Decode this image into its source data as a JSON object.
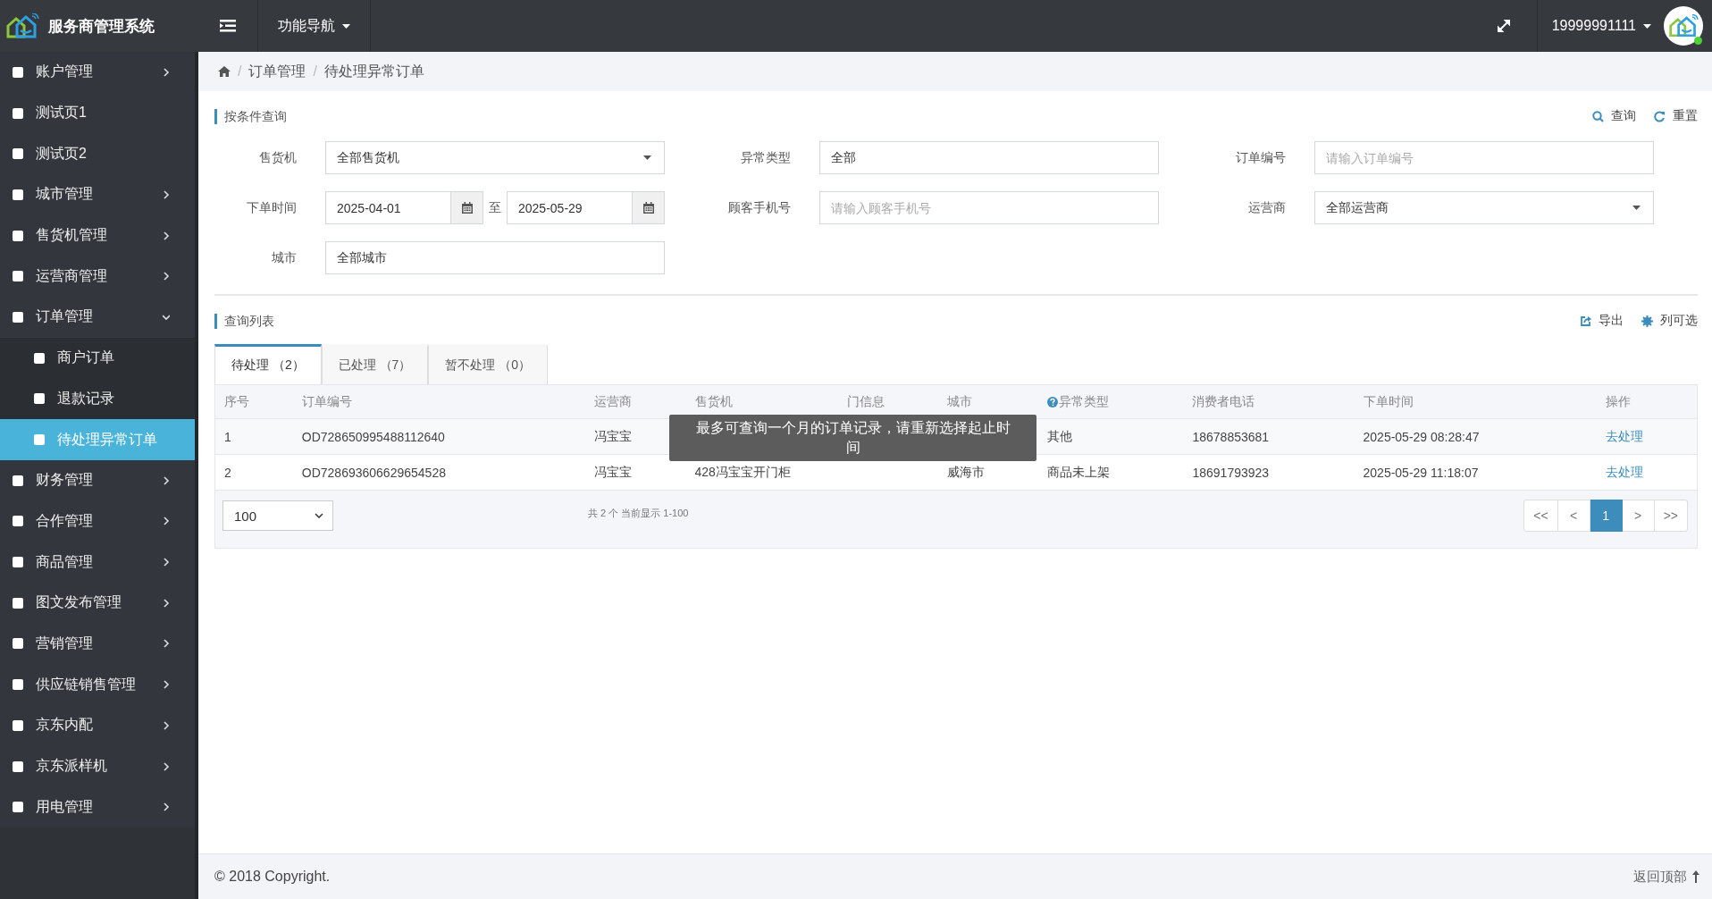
{
  "header": {
    "title": "服务商管理系统",
    "nav_menu": "功能导航",
    "user": "19999991111"
  },
  "sidebar": {
    "items": [
      {
        "label": "账户管理",
        "expanded": false,
        "selected": false
      },
      {
        "label": "测试页1",
        "selected": false
      },
      {
        "label": "测试页2",
        "selected": false
      },
      {
        "label": "城市管理",
        "expanded": false,
        "selected": false
      },
      {
        "label": "售货机管理",
        "expanded": false,
        "selected": false
      },
      {
        "label": "运营商管理",
        "expanded": false,
        "selected": false
      },
      {
        "label": "订单管理",
        "expanded": true,
        "selected": false,
        "children": [
          {
            "label": "商户订单",
            "selected": false
          },
          {
            "label": "退款记录",
            "selected": false
          },
          {
            "label": "待处理异常订单",
            "selected": true
          }
        ]
      },
      {
        "label": "财务管理",
        "expanded": false,
        "selected": false
      },
      {
        "label": "合作管理",
        "expanded": false,
        "selected": false
      },
      {
        "label": "商品管理",
        "expanded": false,
        "selected": false
      },
      {
        "label": "图文发布管理",
        "expanded": false,
        "selected": false
      },
      {
        "label": "营销管理",
        "expanded": false,
        "selected": false
      },
      {
        "label": "供应链销售管理",
        "expanded": false,
        "selected": false
      },
      {
        "label": "京东内配",
        "expanded": false,
        "selected": false
      },
      {
        "label": "京东派样机",
        "expanded": false,
        "selected": false
      },
      {
        "label": "用电管理",
        "expanded": false,
        "selected": false
      }
    ]
  },
  "breadcrumb": {
    "separator": "/",
    "items": [
      "订单管理",
      "待处理异常订单"
    ]
  },
  "filter": {
    "title": "按条件查询",
    "actions": [
      {
        "label": "查询",
        "kind": "search"
      },
      {
        "label": "重置",
        "kind": "reset"
      }
    ],
    "fields": [
      {
        "label": "售货机",
        "kind": "select",
        "value": "全部售货机"
      },
      {
        "label": "异常类型",
        "kind": "text",
        "value": "全部"
      },
      {
        "label": "订单编号",
        "kind": "text",
        "placeholder": "请输入订单编号"
      },
      {
        "label": "下单时间",
        "kind": "daterange",
        "from": "2025-04-01",
        "separator": "至",
        "to": "2025-05-29"
      },
      {
        "label": "顾客手机号",
        "kind": "text",
        "placeholder": "请输入顾客手机号"
      },
      {
        "label": "运营商",
        "kind": "select",
        "value": "全部运营商"
      },
      {
        "label": "城市",
        "kind": "text",
        "value": "全部城市"
      }
    ]
  },
  "list": {
    "title": "查询列表",
    "actions": [
      {
        "label": "导出",
        "kind": "export"
      },
      {
        "label": "列可选",
        "kind": "columns"
      }
    ],
    "tabs": [
      {
        "label": "待处理 （2）",
        "selected": true
      },
      {
        "label": "已处理 （7）",
        "selected": false
      },
      {
        "label": "暂不处理 （0）",
        "selected": false
      }
    ],
    "table": {
      "columns": [
        {
          "label": "序号"
        },
        {
          "label": "订单编号"
        },
        {
          "label": "运营商"
        },
        {
          "label": "售货机"
        },
        {
          "label": "门信息"
        },
        {
          "label": "城市"
        },
        {
          "label": "异常类型",
          "help": true
        },
        {
          "label": "消费者电话"
        },
        {
          "label": "下单时间"
        },
        {
          "label": "操作",
          "kind": "link"
        }
      ],
      "rows": [
        [
          "1",
          "OD728650995488112640",
          "冯宝宝",
          null,
          null,
          null,
          "其他",
          "18678853681",
          "2025-05-29 08:28:47",
          "去处理"
        ],
        [
          "2",
          "OD728693606629654528",
          "冯宝宝",
          "428冯宝宝开门柜",
          null,
          "威海市",
          "商品未上架",
          "18691793923",
          "2025-05-29 11:18:07",
          "去处理"
        ]
      ]
    },
    "page_size": "100",
    "summary": "共 2 个 当前显示 1-100",
    "pagination": [
      {
        "label": "<<",
        "selected": false
      },
      {
        "label": "<",
        "selected": false
      },
      {
        "label": "1",
        "selected": true
      },
      {
        "label": ">",
        "selected": false
      },
      {
        "label": ">>",
        "selected": false
      }
    ]
  },
  "toast": "最多可查询一个月的订单记录，请重新选择起止时间",
  "footer": {
    "copyright": "© 2018 Copyright.",
    "back_to_top": "返回顶部"
  }
}
